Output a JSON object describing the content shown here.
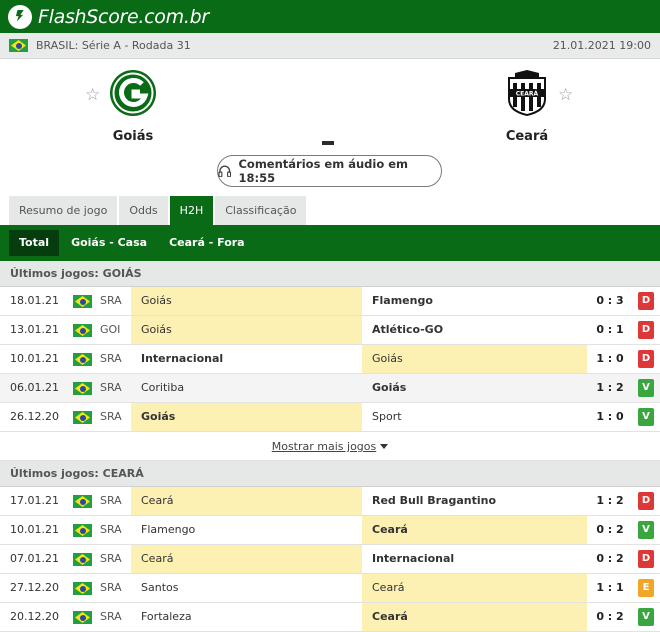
{
  "site": {
    "brand": "FlashScore.com.br"
  },
  "tournament": {
    "name": "BRASIL: Série A - Rodada 31",
    "datetime": "21.01.2021 19:00"
  },
  "match": {
    "home": "Goiás",
    "away": "Ceará",
    "score": "-",
    "audio_label": "Comentários em áudio em 18:55",
    "away_crest_text": "CEARÁ"
  },
  "tabs": [
    "Resumo de jogo",
    "Odds",
    "H2H",
    "Classificação"
  ],
  "subtabs": [
    "Total",
    "Goiás - Casa",
    "Ceará - Fora"
  ],
  "sections": [
    {
      "title": "Últimos jogos: GOIÁS",
      "rows": [
        {
          "date": "18.01.21",
          "comp": "SRA",
          "home": "Goiás",
          "away": "Flamengo",
          "score": "0 : 3",
          "result": "D"
        },
        {
          "date": "13.01.21",
          "comp": "GOI",
          "home": "Goiás",
          "away": "Atlético-GO",
          "score": "0 : 1",
          "result": "D"
        },
        {
          "date": "10.01.21",
          "comp": "SRA",
          "home": "Internacional",
          "away": "Goiás",
          "score": "1 : 0",
          "result": "D"
        },
        {
          "date": "06.01.21",
          "comp": "SRA",
          "home": "Coritiba",
          "away": "Goiás",
          "score": "1 : 2",
          "result": "V"
        },
        {
          "date": "26.12.20",
          "comp": "SRA",
          "home": "Goiás",
          "away": "Sport",
          "score": "1 : 0",
          "result": "V"
        }
      ],
      "more_label": "Mostrar mais jogos"
    },
    {
      "title": "Últimos jogos: CEARÁ",
      "rows": [
        {
          "date": "17.01.21",
          "comp": "SRA",
          "home": "Ceará",
          "away": "Red Bull Bragantino",
          "score": "1 : 2",
          "result": "D"
        },
        {
          "date": "10.01.21",
          "comp": "SRA",
          "home": "Flamengo",
          "away": "Ceará",
          "score": "0 : 2",
          "result": "V"
        },
        {
          "date": "07.01.21",
          "comp": "SRA",
          "home": "Ceará",
          "away": "Internacional",
          "score": "0 : 2",
          "result": "D"
        },
        {
          "date": "27.12.20",
          "comp": "SRA",
          "home": "Santos",
          "away": "Ceará",
          "score": "1 : 1",
          "result": "E"
        },
        {
          "date": "20.12.20",
          "comp": "SRA",
          "home": "Fortaleza",
          "away": "Ceará",
          "score": "0 : 2",
          "result": "V"
        }
      ]
    }
  ],
  "colors": {
    "brand_green": "#0a6b17",
    "highlight": "#fdf0b3",
    "loss": "#dc3838",
    "win": "#3aa63f",
    "draw": "#f0a727"
  }
}
